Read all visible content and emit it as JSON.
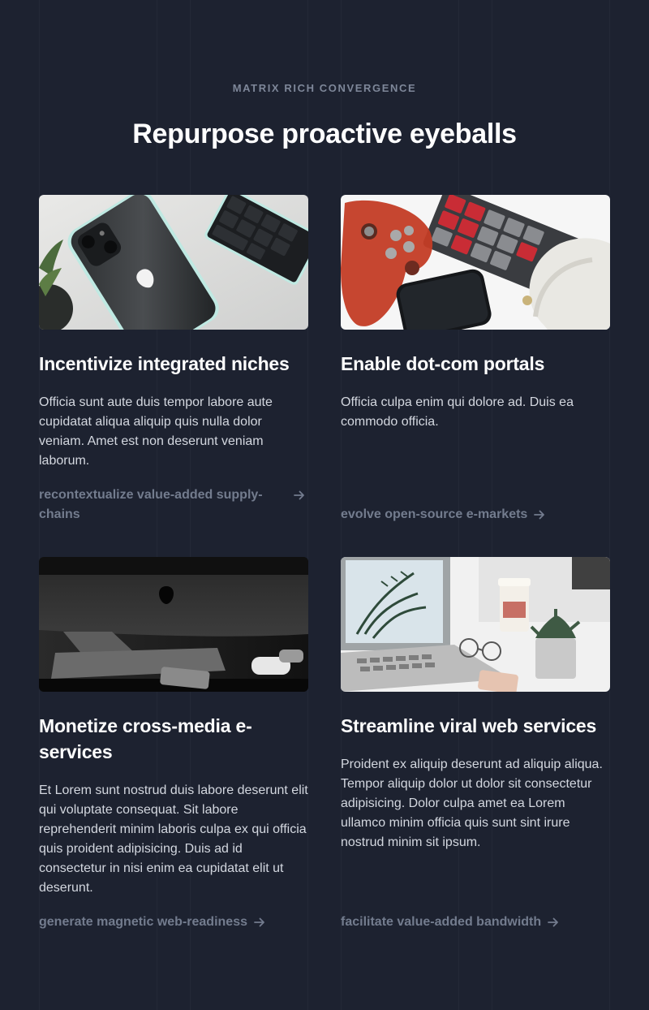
{
  "section": {
    "eyebrow": "MATRIX RICH CONVERGENCE",
    "heading": "Repurpose proactive eyeballs"
  },
  "cards": [
    {
      "image": "iphone-keyboard-photo",
      "title": "Incentivize integrated niches",
      "body": "Officia sunt aute duis tempor labore aute cupidatat aliqua aliquip quis nulla dolor veniam. Amet est non deserunt veniam laborum.",
      "link": "recontextualize value-added supply-chains",
      "icon": "arrow-right-icon"
    },
    {
      "image": "gamepad-keyboard-photo",
      "title": "Enable dot-com portals",
      "body": "Officia culpa enim qui dolore ad. Duis ea commodo officia.",
      "link": "evolve open-source e-markets",
      "icon": "arrow-right-icon"
    },
    {
      "image": "imac-desk-photo",
      "title": "Monetize cross-media e-services",
      "body": "Et Lorem sunt nostrud duis labore deserunt elit qui voluptate consequat. Sit labore reprehenderit minim laboris culpa ex qui officia quis proident adipisicing. Duis ad id consectetur in nisi enim ea cupidatat elit ut deserunt.",
      "link": "generate magnetic web-readiness",
      "icon": "arrow-right-icon"
    },
    {
      "image": "laptop-plant-photo",
      "title": "Streamline viral web services",
      "body": "Proident ex aliquip deserunt ad aliquip aliqua. Tempor aliquip dolor ut dolor sit consectetur adipisicing. Dolor culpa amet ea Lorem ullamco minim officia quis sunt sint irure nostrud minim sit ipsum.",
      "link": "facilitate value-added bandwidth",
      "icon": "arrow-right-icon"
    }
  ],
  "colors": {
    "background": "#1d2230",
    "heading": "#ffffff",
    "body": "#d3d7df",
    "link": "#737c8e",
    "eyebrow": "#7e8799"
  }
}
